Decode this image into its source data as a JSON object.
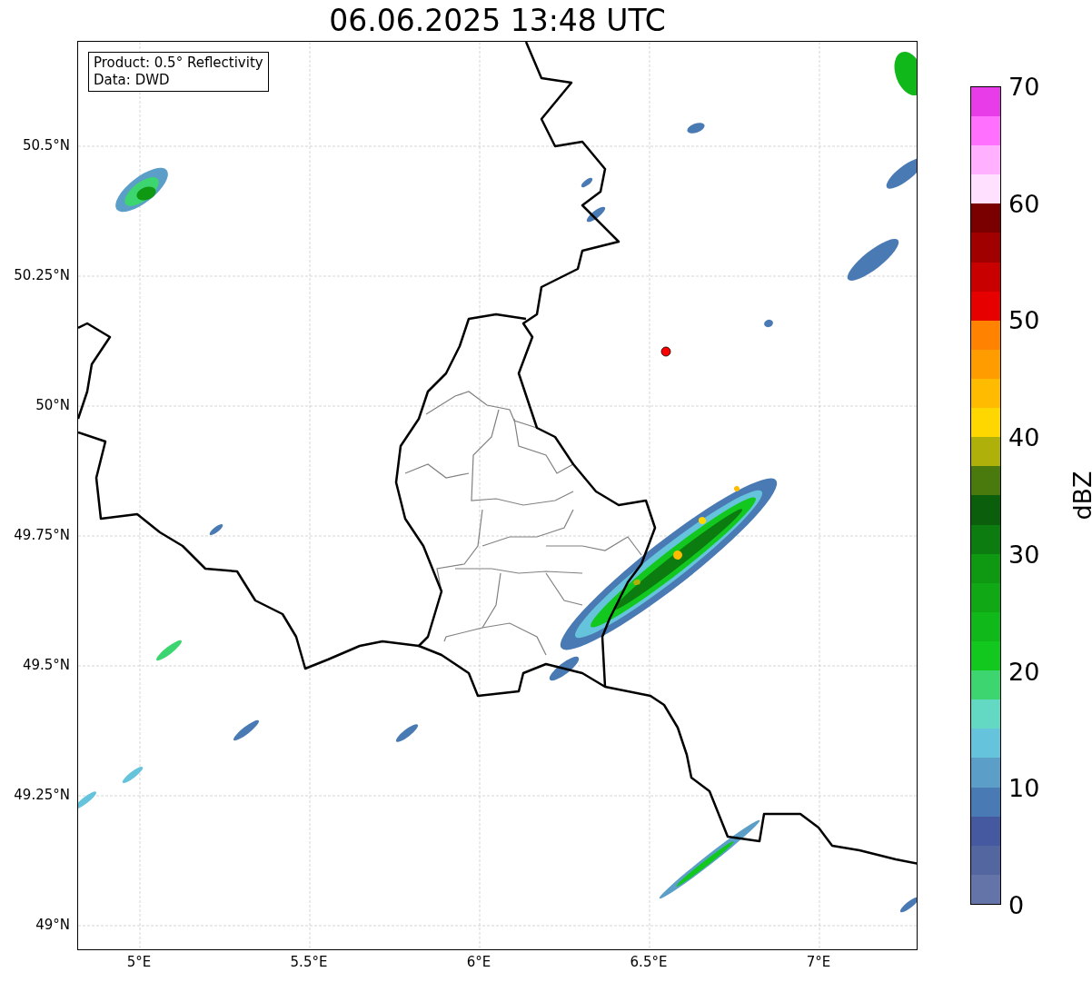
{
  "title": "06.06.2025 13:48 UTC",
  "legend": {
    "lines": [
      "Product: 0.5° Reflectivity",
      "Data: DWD"
    ]
  },
  "map": {
    "xticks": [
      "5°E",
      "5.5°E",
      "6°E",
      "6.5°E",
      "7°E"
    ],
    "yticks": [
      "50.5°N",
      "50.25°N",
      "50°N",
      "49.75°N",
      "49.5°N",
      "49.25°N",
      "49°N"
    ]
  },
  "colorbar": {
    "label": "dBZ",
    "ticks": [
      "70",
      "60",
      "50",
      "40",
      "30",
      "20",
      "10",
      "0"
    ]
  }
}
